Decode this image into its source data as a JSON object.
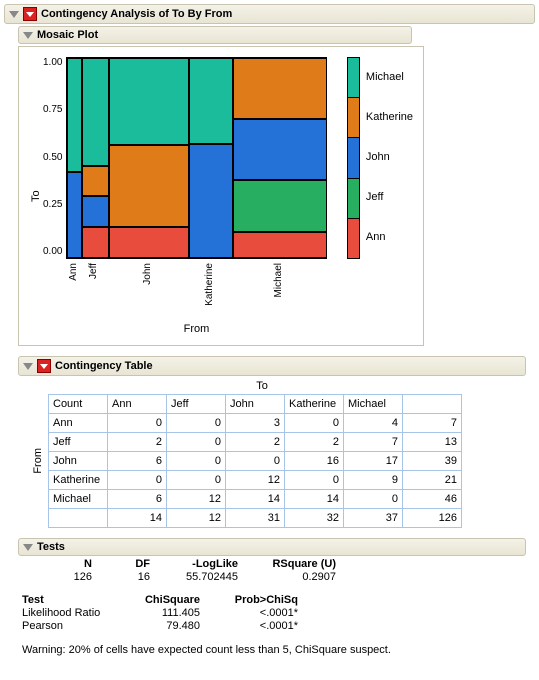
{
  "main_title": "Contingency Analysis of To By From",
  "mosaic_title": "Mosaic Plot",
  "ct_title": "Contingency Table",
  "tests_title": "Tests",
  "axes": {
    "x": "From",
    "y": "To",
    "yticks": [
      "1.00",
      "0.75",
      "0.50",
      "0.25",
      "0.00"
    ],
    "xticks": [
      "Ann",
      "Jeff",
      "John",
      "Katherine",
      "Michael"
    ]
  },
  "legend": [
    "Michael",
    "Katherine",
    "John",
    "Jeff",
    "Ann"
  ],
  "ct": {
    "side": "From",
    "top": "To",
    "count_label": "Count",
    "cols": [
      "Ann",
      "Jeff",
      "John",
      "Katherine",
      "Michael"
    ],
    "rows": [
      {
        "name": "Ann",
        "vals": [
          0,
          0,
          3,
          0,
          4
        ],
        "tot": 7
      },
      {
        "name": "Jeff",
        "vals": [
          2,
          0,
          2,
          2,
          7
        ],
        "tot": 13
      },
      {
        "name": "John",
        "vals": [
          6,
          0,
          0,
          16,
          17
        ],
        "tot": 39
      },
      {
        "name": "Katherine",
        "vals": [
          0,
          0,
          12,
          0,
          9
        ],
        "tot": 21
      },
      {
        "name": "Michael",
        "vals": [
          6,
          12,
          14,
          14,
          0
        ],
        "tot": 46
      }
    ],
    "col_tots": [
      14,
      12,
      31,
      32,
      37
    ],
    "grand": 126
  },
  "tests": {
    "hdr1": [
      "N",
      "DF",
      "-LogLike",
      "RSquare (U)"
    ],
    "row1": [
      "126",
      "16",
      "55.702445",
      "0.2907"
    ],
    "hdr2": [
      "Test",
      "ChiSquare",
      "Prob>ChiSq"
    ],
    "rows2": [
      [
        "Likelihood Ratio",
        "111.405",
        "<.0001*"
      ],
      [
        "Pearson",
        "79.480",
        "<.0001*"
      ]
    ],
    "warning": "Warning: 20% of cells have expected count less than 5, ChiSquare suspect."
  },
  "chart_data": {
    "type": "mosaic",
    "title": "Mosaic Plot",
    "xlabel": "From",
    "ylabel": "To",
    "x_categories": [
      "Ann",
      "Jeff",
      "John",
      "Katherine",
      "Michael"
    ],
    "y_categories": [
      "Ann",
      "Jeff",
      "John",
      "Katherine",
      "Michael"
    ],
    "column_totals": [
      7,
      13,
      39,
      21,
      46
    ],
    "column_proportions": [
      0.0556,
      0.1032,
      0.3095,
      0.1667,
      0.3651
    ],
    "cells": [
      {
        "from": "Ann",
        "to": {
          "Ann": 0,
          "Jeff": 0,
          "John": 3,
          "Katherine": 0,
          "Michael": 4
        }
      },
      {
        "from": "Jeff",
        "to": {
          "Ann": 2,
          "Jeff": 0,
          "John": 2,
          "Katherine": 2,
          "Michael": 7
        }
      },
      {
        "from": "John",
        "to": {
          "Ann": 6,
          "Jeff": 0,
          "John": 0,
          "Katherine": 16,
          "Michael": 17
        }
      },
      {
        "from": "Katherine",
        "to": {
          "Ann": 0,
          "Jeff": 0,
          "John": 12,
          "Katherine": 0,
          "Michael": 9
        }
      },
      {
        "from": "Michael",
        "to": {
          "Ann": 6,
          "Jeff": 12,
          "John": 14,
          "Katherine": 14,
          "Michael": 0
        }
      }
    ],
    "grand_total": 126,
    "colors": {
      "Ann": "#e74c3c",
      "Jeff": "#27ae60",
      "John": "#2471d8",
      "Katherine": "#e07b1a",
      "Michael": "#1abc9c"
    }
  }
}
